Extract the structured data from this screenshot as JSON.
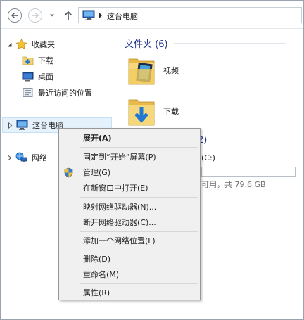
{
  "address_bar": {
    "crumb": "这台电脑"
  },
  "nav_pane": {
    "favorites": "收藏夹",
    "downloads": "下载",
    "desktop": "桌面",
    "recent": "最近访问的位置",
    "this_pc": "这台电脑",
    "network": "网络"
  },
  "content": {
    "folders_header": "文件夹 (6)",
    "folders": [
      {
        "name": "视频",
        "icon": "video-folder-icon"
      },
      {
        "name": "下载",
        "icon": "downloads-folder-icon"
      }
    ],
    "devices_header_peek": "2)",
    "drive_label": "(C:)",
    "drive_free": "可用，共 79.6 GB"
  },
  "context_menu": {
    "expand": "展开(A)",
    "pin_start": "固定到“开始”屏幕(P)",
    "manage": "管理(G)",
    "open_new_window": "在新窗口中打开(E)",
    "map_drive": "映射网络驱动器(N)...",
    "disconnect_drive": "断开网络驱动器(C)...",
    "add_network_location": "添加一个网络位置(L)",
    "delete": "删除(D)",
    "rename": "重命名(M)",
    "properties": "属性(R)"
  },
  "colors": {
    "accent_header": "#1e3287",
    "selection": "#e5f1fb",
    "menu_bg": "#f0f0f0"
  }
}
